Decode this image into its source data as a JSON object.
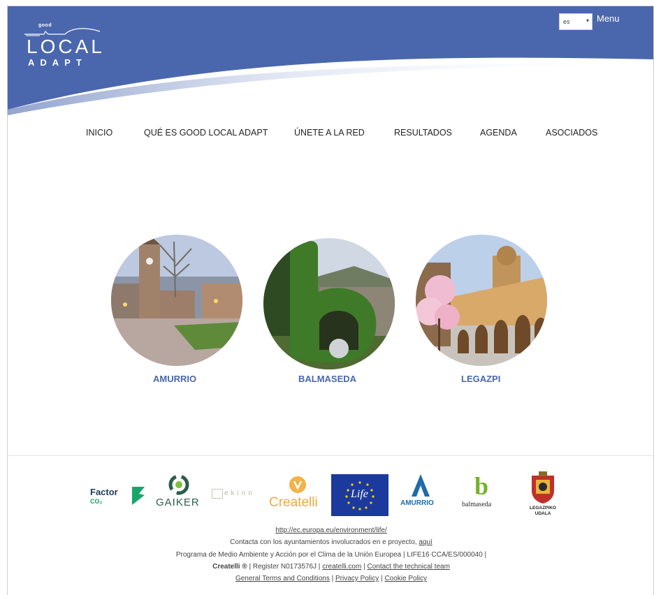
{
  "header": {
    "logo_small": "good",
    "logo_big": "LOCAL",
    "logo_sub": "ADAPT",
    "lang_value": "es",
    "menu_label": "Menu"
  },
  "nav": [
    "INICIO",
    "QUÉ ES GOOD LOCAL ADAPT",
    "ÚNETE A LA RED",
    "RESULTADOS",
    "AGENDA",
    "ASOCIADOS"
  ],
  "cities": [
    {
      "name": "AMURRIO"
    },
    {
      "name": "BALMASEDA"
    },
    {
      "name": "LEGAZPI"
    }
  ],
  "sponsors": {
    "factor": "Factor",
    "factor_sub": "CO₂",
    "gaiker": "GAIKER",
    "ekinn": "ekinn",
    "createlli": "Createlli",
    "life": "Life",
    "amurrio": "AMURRIO",
    "balmaseda": "balmaseda",
    "legazpi": "LEGAZPIKO UDALA"
  },
  "footer": {
    "life_link": "http://ec.europa.eu/environment/life/",
    "contact_text": "Contacta con los ayuntamientos involucrados en e proyecto,",
    "contact_link": "aquí",
    "program": "Programa de Medio Ambiente y Acción por el Clima de la Unión Europea  | LIFE16 CCA/ES/000040 |",
    "createlli_brand": "Createlli ®",
    "register": "| Register N0173576J |",
    "createlli_link": "createlli.com",
    "sep": "|",
    "technical_link": "Contact the technical team",
    "terms_link": "General Terms and Conditions",
    "privacy_link": "Privacy Policy",
    "cookie_link": "Cookie Policy"
  },
  "colors": {
    "brand_blue": "#4a67ad",
    "life_blue": "#1c3a9e"
  }
}
